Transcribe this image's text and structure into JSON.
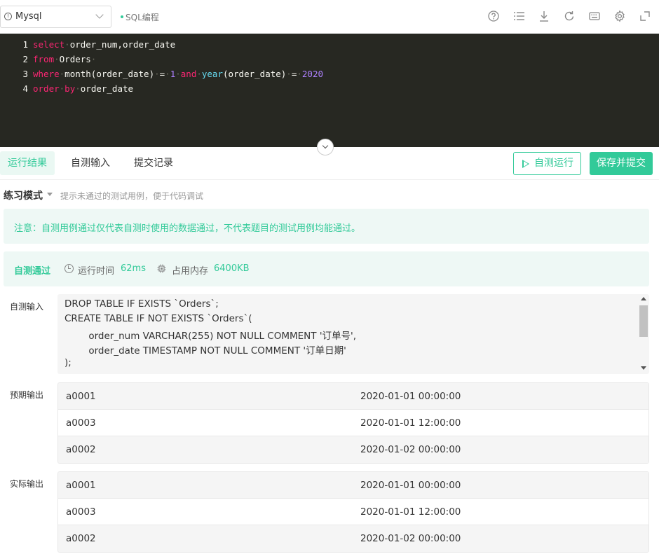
{
  "toolbar": {
    "language": "Mysql",
    "mode_tag": "SQL编程",
    "icons": [
      "help-icon",
      "list-icon",
      "download-icon",
      "refresh-icon",
      "keyboard-icon",
      "settings-icon",
      "fullscreen-icon"
    ]
  },
  "editor": {
    "lines": [
      {
        "num": "1",
        "tokens": [
          [
            "kw",
            "select"
          ],
          [
            "ws",
            "·"
          ],
          [
            "tx",
            "order_num,order_date"
          ]
        ]
      },
      {
        "num": "2",
        "tokens": [
          [
            "kw",
            "from"
          ],
          [
            "ws",
            "·"
          ],
          [
            "tx",
            "Orders"
          ],
          [
            "ws",
            "·"
          ]
        ]
      },
      {
        "num": "3",
        "tokens": [
          [
            "kw",
            "where"
          ],
          [
            "ws",
            "·"
          ],
          [
            "tx",
            "month(order_date)"
          ],
          [
            "ws",
            "·"
          ],
          [
            "tx",
            "="
          ],
          [
            "ws",
            "·"
          ],
          [
            "num",
            "1"
          ],
          [
            "ws",
            "·"
          ],
          [
            "kw",
            "and"
          ],
          [
            "ws",
            "·"
          ],
          [
            "fn",
            "year"
          ],
          [
            "tx",
            "(order_date)"
          ],
          [
            "ws",
            "·"
          ],
          [
            "tx",
            "="
          ],
          [
            "ws",
            "·"
          ],
          [
            "num",
            "2020"
          ]
        ]
      },
      {
        "num": "4",
        "tokens": [
          [
            "kw",
            "order"
          ],
          [
            "ws",
            "·"
          ],
          [
            "kw",
            "by"
          ],
          [
            "ws",
            "·"
          ],
          [
            "tx",
            "order_date"
          ]
        ]
      }
    ]
  },
  "tabs": {
    "results": "运行结果",
    "custom_input": "自测输入",
    "history": "提交记录",
    "run_button": "自测运行",
    "submit_button": "保存并提交"
  },
  "practice": {
    "title": "练习模式",
    "hint": "提示未通过的测试用例，便于代码调试"
  },
  "notice": "注意：自测用例通过仅代表自测时使用的数据通过，不代表题目的测试用例均能通过。",
  "status": {
    "result": "自测通过",
    "time_label": "运行时间",
    "time_value": "62ms",
    "memory_label": "占用内存",
    "memory_value": "6400KB"
  },
  "sections": {
    "input_label": "自测输入",
    "expected_label": "预期输出",
    "actual_label": "实际输出"
  },
  "input_lines": [
    "DROP TABLE IF EXISTS `Orders`;",
    "CREATE TABLE IF NOT EXISTS `Orders`(",
    "        order_num VARCHAR(255) NOT NULL COMMENT '订单号',",
    "        order_date TIMESTAMP NOT NULL COMMENT '订单日期'",
    ");"
  ],
  "expected_rows": [
    [
      "a0001",
      "2020-01-01 00:00:00"
    ],
    [
      "a0003",
      "2020-01-01 12:00:00"
    ],
    [
      "a0002",
      "2020-01-02 00:00:00"
    ]
  ],
  "actual_rows": [
    [
      "a0001",
      "2020-01-01 00:00:00"
    ],
    [
      "a0003",
      "2020-01-01 12:00:00"
    ],
    [
      "a0002",
      "2020-01-02 00:00:00"
    ]
  ]
}
